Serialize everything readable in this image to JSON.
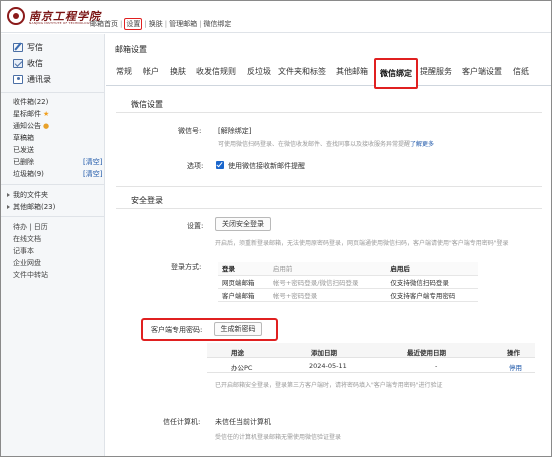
{
  "brand": {
    "logo_text": "南京工程学院",
    "logo_sub": "NANJING INSTITUTE OF TECHNOLOGY"
  },
  "topnav": {
    "home": "邮箱首页",
    "settings": "设置",
    "switch": "换肤",
    "manage": "管理邮箱",
    "wechat": "微信绑定",
    "sep": "|"
  },
  "sidebar": {
    "write": "写信",
    "receive": "收信",
    "contacts": "通讯录",
    "items": [
      {
        "label": "收件箱(22)"
      },
      {
        "label": "星标邮件"
      },
      {
        "label": "通知公告"
      },
      {
        "label": "草稿箱"
      },
      {
        "label": "已发送"
      },
      {
        "label": "已删除",
        "action": "[清空]"
      },
      {
        "label": "垃圾箱(9)",
        "action": "[清空]"
      }
    ],
    "groups": [
      {
        "label": "我的文件夹"
      },
      {
        "label": "其他邮箱(23)"
      }
    ],
    "tools": [
      {
        "label": "待办 | 日历"
      },
      {
        "label": "在线文档"
      },
      {
        "label": "记事本"
      },
      {
        "label": "企业网盘"
      },
      {
        "label": "文件中转站"
      }
    ]
  },
  "page": {
    "title": "邮箱设置",
    "tabs": [
      "常规",
      "帐户",
      "换肤",
      "收发信规则",
      "反垃圾",
      "文件夹和标签",
      "其他邮箱",
      "微信绑定",
      "提醒服务",
      "客户端设置",
      "信纸"
    ],
    "active_tab": "微信绑定"
  },
  "wechat_section": {
    "title": "微信设置",
    "wechat_label": "微信号:",
    "unbind": "[解除绑定]",
    "desc_prefix": "可使用微信扫码登录、在微信收发邮件、查找同事以及接收服务异常提醒",
    "learn_more": "了解更多",
    "option_label": "选项:",
    "option_text": "使用微信接收新邮件提醒",
    "option_checked": true
  },
  "security_section": {
    "title": "安全登录",
    "setting_label": "设置:",
    "close_button": "关闭安全登录",
    "setting_desc": "开启后，须重新登录邮箱，无法使用原密码登录，网页端通使用微信扫码，客户端请使用\"客户端专用密码\"登录",
    "login_label": "登录方式:",
    "login_table": {
      "headers": [
        "登录",
        "启用前",
        "启用后"
      ],
      "rows": [
        [
          "网页端邮箱",
          "帐号+密码登录/微信扫码登录",
          "仅支持微信扫码登录"
        ],
        [
          "客户端邮箱",
          "帐号+密码登录",
          "仅支持客户端专用密码"
        ]
      ]
    },
    "client_pw_label": "客户端专用密码:",
    "gen_button": "生成新密码",
    "pw_table": {
      "headers": [
        "用途",
        "添加日期",
        "最近使用日期",
        "操作"
      ],
      "rows": [
        [
          "办公PC",
          "2024-05-11",
          "-",
          "停用"
        ]
      ]
    },
    "pw_desc": "已开启邮箱安全登录，登录第三方客户端时，请将密码填入\"客户端专用密码\"进行验证",
    "trusted_label": "信任计算机:",
    "trusted_value": "未信任当前计算机",
    "trusted_desc": "受信任的计算机登录邮箱无需使用微信验证登录"
  },
  "colors": {
    "highlight": "#e02020",
    "link": "#1a55a8",
    "brand": "#7a1414",
    "checkbox": "#1a66cc"
  }
}
